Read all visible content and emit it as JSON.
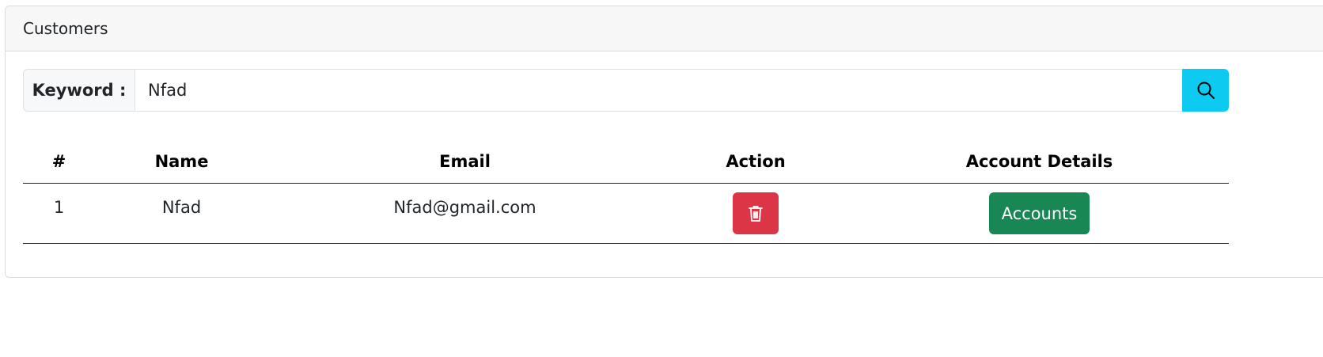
{
  "card": {
    "title": "Customers"
  },
  "search": {
    "label": "Keyword :",
    "value": "Nfad",
    "button_icon": "search-icon"
  },
  "table": {
    "headers": [
      "#",
      "Name",
      "Email",
      "Action",
      "Account Details"
    ],
    "rows": [
      {
        "num": "1",
        "name": "Nfad",
        "email": "Nfad@gmail.com",
        "action_icon": "trash-icon",
        "accounts_label": "Accounts"
      }
    ]
  },
  "colors": {
    "delete": "#dc3545",
    "accounts": "#198754",
    "search_button": "#0dcaf0"
  }
}
